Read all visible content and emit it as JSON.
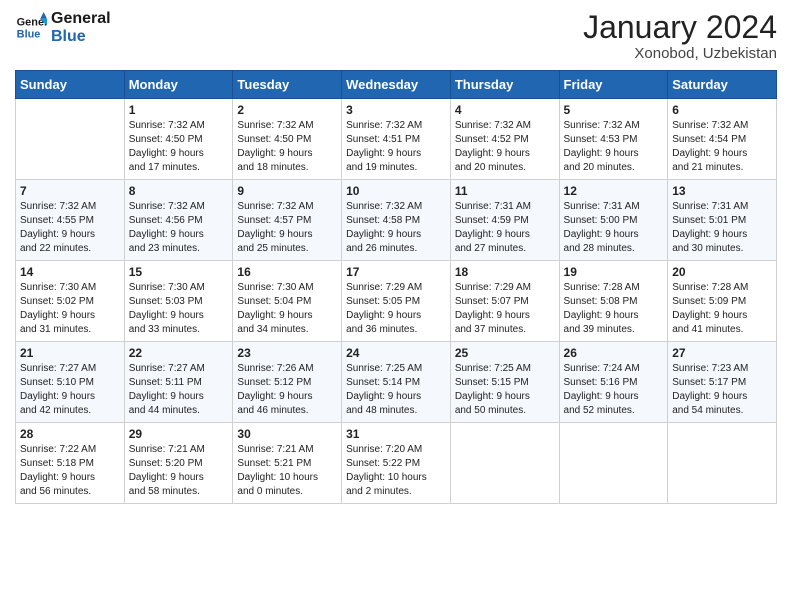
{
  "header": {
    "logo_line1": "General",
    "logo_line2": "Blue",
    "month_title": "January 2024",
    "location": "Xonobod, Uzbekistan"
  },
  "weekdays": [
    "Sunday",
    "Monday",
    "Tuesday",
    "Wednesday",
    "Thursday",
    "Friday",
    "Saturday"
  ],
  "weeks": [
    [
      {
        "day": "",
        "info": ""
      },
      {
        "day": "1",
        "info": "Sunrise: 7:32 AM\nSunset: 4:50 PM\nDaylight: 9 hours\nand 17 minutes."
      },
      {
        "day": "2",
        "info": "Sunrise: 7:32 AM\nSunset: 4:50 PM\nDaylight: 9 hours\nand 18 minutes."
      },
      {
        "day": "3",
        "info": "Sunrise: 7:32 AM\nSunset: 4:51 PM\nDaylight: 9 hours\nand 19 minutes."
      },
      {
        "day": "4",
        "info": "Sunrise: 7:32 AM\nSunset: 4:52 PM\nDaylight: 9 hours\nand 20 minutes."
      },
      {
        "day": "5",
        "info": "Sunrise: 7:32 AM\nSunset: 4:53 PM\nDaylight: 9 hours\nand 20 minutes."
      },
      {
        "day": "6",
        "info": "Sunrise: 7:32 AM\nSunset: 4:54 PM\nDaylight: 9 hours\nand 21 minutes."
      }
    ],
    [
      {
        "day": "7",
        "info": "Sunrise: 7:32 AM\nSunset: 4:55 PM\nDaylight: 9 hours\nand 22 minutes."
      },
      {
        "day": "8",
        "info": "Sunrise: 7:32 AM\nSunset: 4:56 PM\nDaylight: 9 hours\nand 23 minutes."
      },
      {
        "day": "9",
        "info": "Sunrise: 7:32 AM\nSunset: 4:57 PM\nDaylight: 9 hours\nand 25 minutes."
      },
      {
        "day": "10",
        "info": "Sunrise: 7:32 AM\nSunset: 4:58 PM\nDaylight: 9 hours\nand 26 minutes."
      },
      {
        "day": "11",
        "info": "Sunrise: 7:31 AM\nSunset: 4:59 PM\nDaylight: 9 hours\nand 27 minutes."
      },
      {
        "day": "12",
        "info": "Sunrise: 7:31 AM\nSunset: 5:00 PM\nDaylight: 9 hours\nand 28 minutes."
      },
      {
        "day": "13",
        "info": "Sunrise: 7:31 AM\nSunset: 5:01 PM\nDaylight: 9 hours\nand 30 minutes."
      }
    ],
    [
      {
        "day": "14",
        "info": "Sunrise: 7:30 AM\nSunset: 5:02 PM\nDaylight: 9 hours\nand 31 minutes."
      },
      {
        "day": "15",
        "info": "Sunrise: 7:30 AM\nSunset: 5:03 PM\nDaylight: 9 hours\nand 33 minutes."
      },
      {
        "day": "16",
        "info": "Sunrise: 7:30 AM\nSunset: 5:04 PM\nDaylight: 9 hours\nand 34 minutes."
      },
      {
        "day": "17",
        "info": "Sunrise: 7:29 AM\nSunset: 5:05 PM\nDaylight: 9 hours\nand 36 minutes."
      },
      {
        "day": "18",
        "info": "Sunrise: 7:29 AM\nSunset: 5:07 PM\nDaylight: 9 hours\nand 37 minutes."
      },
      {
        "day": "19",
        "info": "Sunrise: 7:28 AM\nSunset: 5:08 PM\nDaylight: 9 hours\nand 39 minutes."
      },
      {
        "day": "20",
        "info": "Sunrise: 7:28 AM\nSunset: 5:09 PM\nDaylight: 9 hours\nand 41 minutes."
      }
    ],
    [
      {
        "day": "21",
        "info": "Sunrise: 7:27 AM\nSunset: 5:10 PM\nDaylight: 9 hours\nand 42 minutes."
      },
      {
        "day": "22",
        "info": "Sunrise: 7:27 AM\nSunset: 5:11 PM\nDaylight: 9 hours\nand 44 minutes."
      },
      {
        "day": "23",
        "info": "Sunrise: 7:26 AM\nSunset: 5:12 PM\nDaylight: 9 hours\nand 46 minutes."
      },
      {
        "day": "24",
        "info": "Sunrise: 7:25 AM\nSunset: 5:14 PM\nDaylight: 9 hours\nand 48 minutes."
      },
      {
        "day": "25",
        "info": "Sunrise: 7:25 AM\nSunset: 5:15 PM\nDaylight: 9 hours\nand 50 minutes."
      },
      {
        "day": "26",
        "info": "Sunrise: 7:24 AM\nSunset: 5:16 PM\nDaylight: 9 hours\nand 52 minutes."
      },
      {
        "day": "27",
        "info": "Sunrise: 7:23 AM\nSunset: 5:17 PM\nDaylight: 9 hours\nand 54 minutes."
      }
    ],
    [
      {
        "day": "28",
        "info": "Sunrise: 7:22 AM\nSunset: 5:18 PM\nDaylight: 9 hours\nand 56 minutes."
      },
      {
        "day": "29",
        "info": "Sunrise: 7:21 AM\nSunset: 5:20 PM\nDaylight: 9 hours\nand 58 minutes."
      },
      {
        "day": "30",
        "info": "Sunrise: 7:21 AM\nSunset: 5:21 PM\nDaylight: 10 hours\nand 0 minutes."
      },
      {
        "day": "31",
        "info": "Sunrise: 7:20 AM\nSunset: 5:22 PM\nDaylight: 10 hours\nand 2 minutes."
      },
      {
        "day": "",
        "info": ""
      },
      {
        "day": "",
        "info": ""
      },
      {
        "day": "",
        "info": ""
      }
    ]
  ]
}
